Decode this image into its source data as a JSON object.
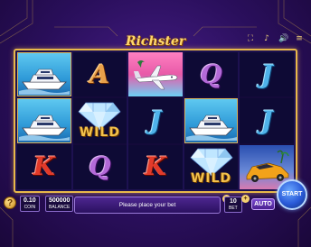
{
  "game": {
    "logo_text": "Richster"
  },
  "top_icons": [
    {
      "name": "fullscreen-icon",
      "glyph": "⛶"
    },
    {
      "name": "music-icon",
      "glyph": "♪"
    },
    {
      "name": "sound-icon",
      "glyph": "🔊"
    },
    {
      "name": "menu-icon",
      "glyph": "≡"
    }
  ],
  "reels": [
    [
      {
        "symbol": "yacht",
        "icon": "yacht-icon"
      },
      {
        "symbol": "yacht",
        "icon": "yacht-icon"
      },
      {
        "symbol": "K",
        "icon": "letter-k"
      }
    ],
    [
      {
        "symbol": "A",
        "icon": "letter-a"
      },
      {
        "symbol": "wild",
        "icon": "diamond-icon",
        "label": "WILD"
      },
      {
        "symbol": "Q",
        "icon": "letter-q"
      }
    ],
    [
      {
        "symbol": "jet",
        "icon": "jet-icon"
      },
      {
        "symbol": "J",
        "icon": "letter-j"
      },
      {
        "symbol": "K",
        "icon": "letter-k"
      }
    ],
    [
      {
        "symbol": "Q",
        "icon": "letter-q"
      },
      {
        "symbol": "yacht",
        "icon": "yacht-icon"
      },
      {
        "symbol": "wild",
        "icon": "diamond-icon",
        "label": "WILD"
      }
    ],
    [
      {
        "symbol": "J",
        "icon": "letter-j"
      },
      {
        "symbol": "J",
        "icon": "letter-j"
      },
      {
        "symbol": "car",
        "icon": "car-icon"
      }
    ]
  ],
  "panel": {
    "help_label": "?",
    "bet_value": "0.10",
    "bet_label": "COIN",
    "balance_value": "500000",
    "balance_label": "BALANCE",
    "message": "Please place your bet",
    "lines_value": "10",
    "lines_label": "BET",
    "minus_label": "-",
    "plus_label": "+",
    "auto_label": "AUTO",
    "start_label": "START"
  },
  "colors": {
    "frame": "#e8b84a",
    "background": "#2a0f5c",
    "start_button": "#2a5ad8"
  }
}
